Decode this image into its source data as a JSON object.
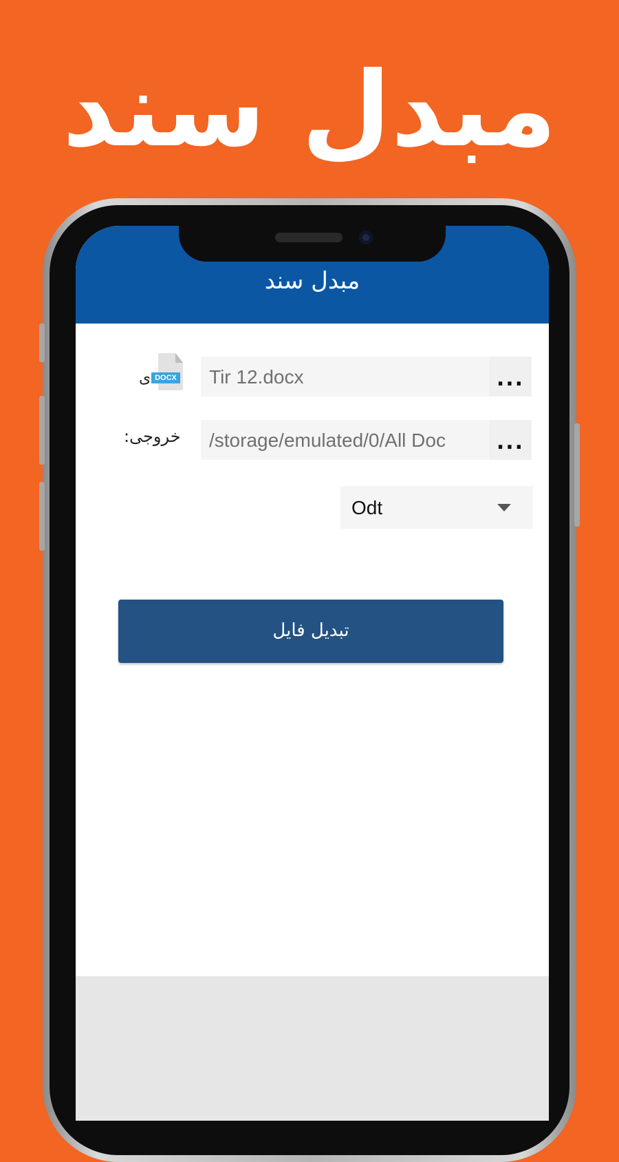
{
  "promo": {
    "title": "مبدل سند"
  },
  "appbar": {
    "title": "مبدل سند"
  },
  "input_file": {
    "value": "Tir 12.docx",
    "browse_label": "...",
    "icon_badge": "DOCX",
    "label_fragment": "ی"
  },
  "output_path": {
    "label": "خروجی:",
    "value": "/storage/emulated/0/All Doc",
    "browse_label": "..."
  },
  "format_select": {
    "selected": "Odt"
  },
  "convert_button": {
    "label": "تبدیل فایل"
  },
  "colors": {
    "background": "#f26522",
    "appbar": "#0b57a4",
    "button": "#235283"
  }
}
